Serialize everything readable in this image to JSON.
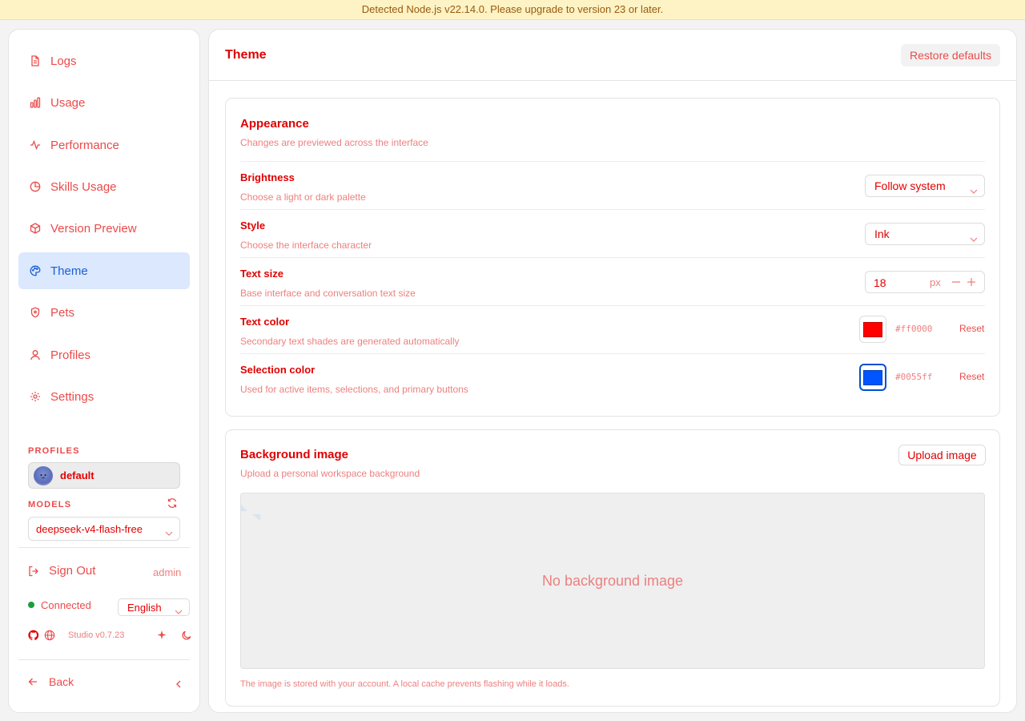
{
  "banner": {
    "text": "Detected Node.js v22.14.0. Please upgrade to version 23 or later."
  },
  "sidebar": {
    "items": [
      {
        "label": "Logs",
        "icon": "file-text-icon"
      },
      {
        "label": "Usage",
        "icon": "bar-chart-icon"
      },
      {
        "label": "Performance",
        "icon": "activity-icon"
      },
      {
        "label": "Skills Usage",
        "icon": "pie-chart-icon"
      },
      {
        "label": "Version Preview",
        "icon": "package-icon"
      },
      {
        "label": "Theme",
        "icon": "palette-icon",
        "active": true
      },
      {
        "label": "Pets",
        "icon": "shield-icon"
      },
      {
        "label": "Profiles",
        "icon": "user-icon"
      },
      {
        "label": "Settings",
        "icon": "gear-icon"
      }
    ],
    "profiles_label": "PROFILES",
    "profile_name": "default",
    "models_label": "MODELS",
    "model_value": "deepseek-v4-flash-free",
    "signout_label": "Sign Out",
    "user": "admin",
    "status": "Connected",
    "language": "English",
    "version": "Studio v0.7.23",
    "back_label": "Back"
  },
  "main": {
    "title": "Theme",
    "restore_label": "Restore defaults",
    "appearance": {
      "title": "Appearance",
      "subtitle": "Changes are previewed across the interface",
      "rows": {
        "brightness": {
          "label": "Brightness",
          "desc": "Choose a light or dark palette",
          "value": "Follow system"
        },
        "style": {
          "label": "Style",
          "desc": "Choose the interface character",
          "value": "Ink"
        },
        "text_size": {
          "label": "Text size",
          "desc": "Base interface and conversation text size",
          "value": "18",
          "unit": "px"
        },
        "text_color": {
          "label": "Text color",
          "desc": "Secondary text shades are generated automatically",
          "hex": "#ff0000",
          "reset": "Reset"
        },
        "selection_color": {
          "label": "Selection color",
          "desc": "Used for active items, selections, and primary buttons",
          "hex": "#0055ff",
          "reset": "Reset"
        }
      }
    },
    "background": {
      "title": "Background image",
      "subtitle": "Upload a personal workspace background",
      "upload_label": "Upload image",
      "empty_text": "No background image",
      "note": "The image is stored with your account. A local cache prevents flashing while it loads."
    }
  },
  "colors": {
    "accent": "#ff0000",
    "selection": "#0055ff",
    "active_bg": "#dbe8fd",
    "connected": "#1a9e3b"
  }
}
